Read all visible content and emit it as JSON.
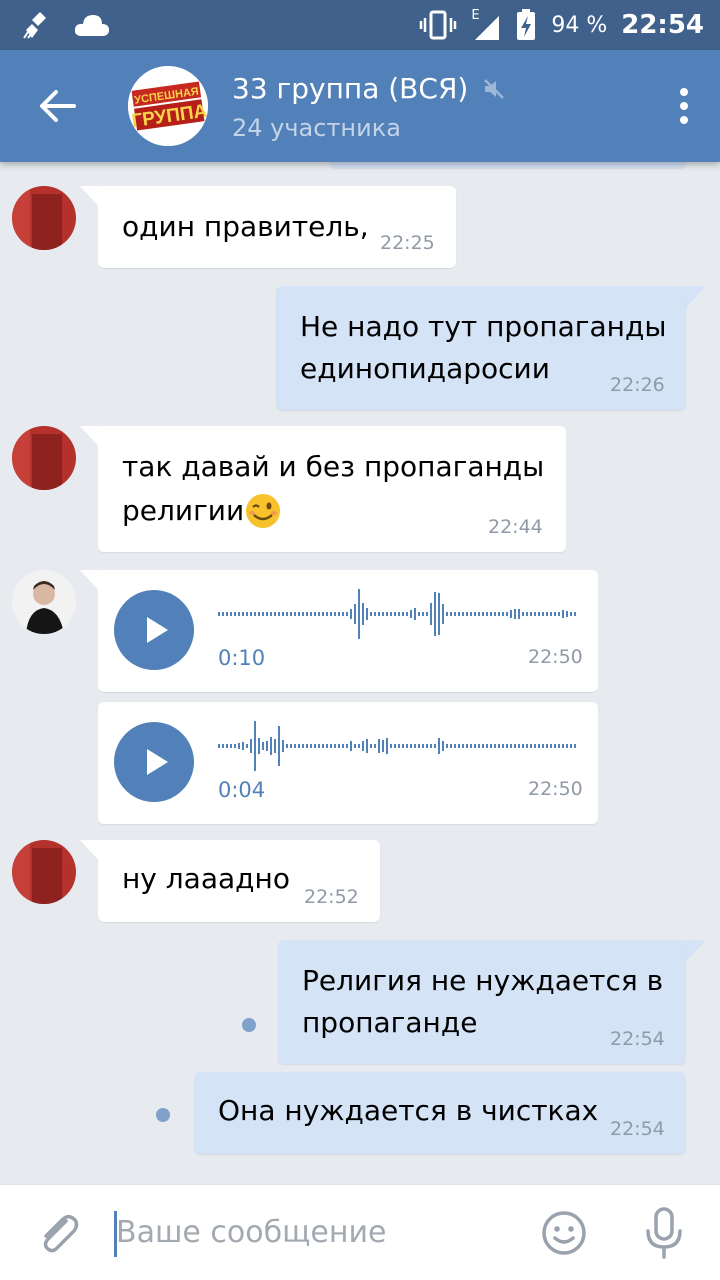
{
  "status_bar": {
    "network": "E",
    "battery": "94 %",
    "time": "22:54"
  },
  "header": {
    "title": "33 группа (ВСЯ)",
    "subtitle": "24 участника",
    "logo_text_top": "УСПЕШНАЯ",
    "logo_text_bottom": "ГРУППА"
  },
  "messages": [
    {
      "text": "один правитель,",
      "time": "22:25"
    },
    {
      "text_line1": "Не надо тут пропаганды",
      "text_line2": "единопидаросии",
      "time": "22:26"
    },
    {
      "text_line1": "так давай и без пропаганды",
      "text_line2": "религии",
      "time": "22:44"
    },
    {
      "duration": "0:10",
      "time": "22:50"
    },
    {
      "duration": "0:04",
      "time": "22:50"
    },
    {
      "text": "ну лааадно",
      "time": "22:52"
    },
    {
      "text_line1": "Религия не нуждается в",
      "text_line2": "пропаганде",
      "time": "22:54"
    },
    {
      "text": "Она нуждается в чистках",
      "time": "22:54"
    }
  ],
  "composer": {
    "placeholder": "Ваше сообщение"
  },
  "colors": {
    "status_bar": "#40618b",
    "header": "#5181b8",
    "background": "#e7ebf0",
    "outgoing_bubble": "#d4e3f6",
    "incoming_bubble": "#ffffff",
    "accent": "#5181b8"
  }
}
